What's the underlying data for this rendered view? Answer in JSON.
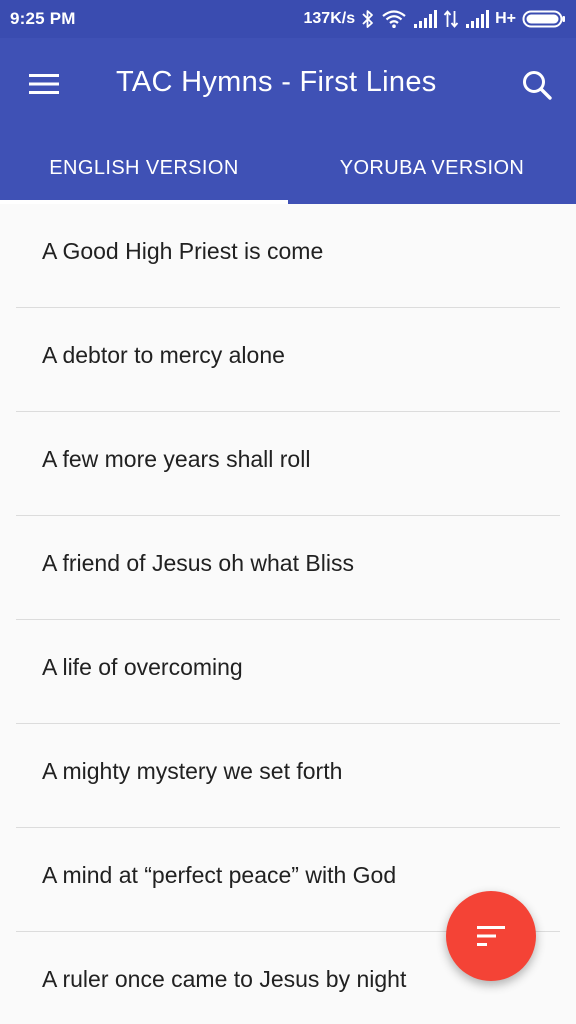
{
  "status_bar": {
    "time": "9:25 PM",
    "speed": "137K/s",
    "network": "H+",
    "icons": [
      "bluetooth-icon",
      "wifi-icon",
      "signal-icon",
      "data-arrows-icon",
      "signal-icon",
      "battery-icon"
    ]
  },
  "app_bar": {
    "title": "TAC Hymns - First Lines",
    "menu_icon": "menu-icon",
    "search_icon": "search-icon"
  },
  "tabs": [
    {
      "label": "ENGLISH VERSION",
      "selected": true
    },
    {
      "label": "YORUBA VERSION",
      "selected": false
    }
  ],
  "hymns": [
    "A Good High Priest is come",
    "A debtor to mercy alone",
    "A few more years shall roll",
    "A friend of Jesus oh what Bliss",
    "A life of overcoming",
    "A mighty mystery we set forth",
    "A mind at “perfect peace” with God",
    "A ruler once came to Jesus by night"
  ],
  "fab": {
    "icon": "sort-icon"
  },
  "colors": {
    "primary": "#3f51b5",
    "status_bar": "#3a4cb0",
    "fab": "#f44336",
    "text": "#212121",
    "divider": "#dcdcdc"
  }
}
